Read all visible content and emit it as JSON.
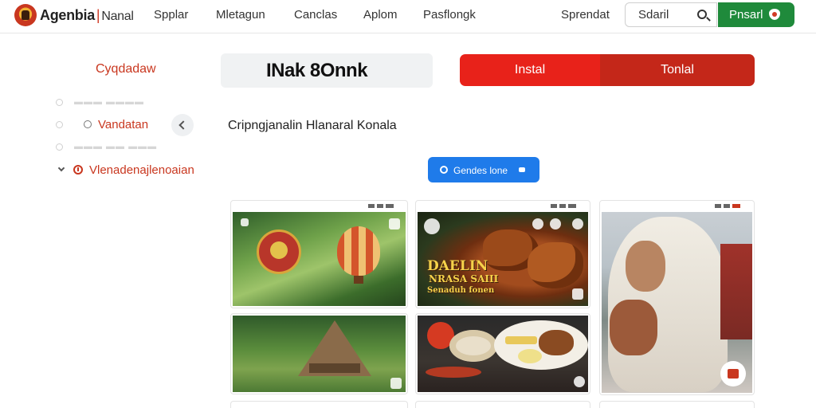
{
  "header": {
    "brand": "Agenbia",
    "brand_sub": "Nanal",
    "nav": [
      "Spplar",
      "Mletagun",
      "Canclas",
      "Aplom",
      "Pasflongk"
    ],
    "right_link": "Sprendat",
    "search_value": "Sdaril",
    "action_button": "Pnsarl"
  },
  "sidebar": {
    "title": "Cyqdadaw",
    "items": [
      {
        "label": "",
        "state": "faint"
      },
      {
        "label": "Vandatan",
        "state": "active"
      },
      {
        "label": "",
        "state": "faint"
      },
      {
        "label": "Vlenadenajlenoaian",
        "state": "expanded"
      }
    ]
  },
  "main": {
    "title": "INak 8Onnk",
    "tabs": [
      "Instal",
      "Tonlal"
    ],
    "subtitle": "Cripngjanalin Hlanaral Konala",
    "primary_button": "Gendes lone",
    "cards": [
      {
        "name": "card-tropical-balloon",
        "overlay": ""
      },
      {
        "name": "card-grilled-meat",
        "overlay": "DAELIN\nNRASA SAIII\nSenaduh fonen"
      },
      {
        "name": "card-woman-hijab",
        "overlay": ""
      },
      {
        "name": "card-thatched-hut",
        "overlay": ""
      },
      {
        "name": "card-food-plates",
        "overlay": ""
      }
    ]
  },
  "colors": {
    "accent_red": "#e8221a",
    "accent_red_dark": "#c42719",
    "brand_green": "#1f8a3b",
    "button_blue": "#1f7bea"
  }
}
